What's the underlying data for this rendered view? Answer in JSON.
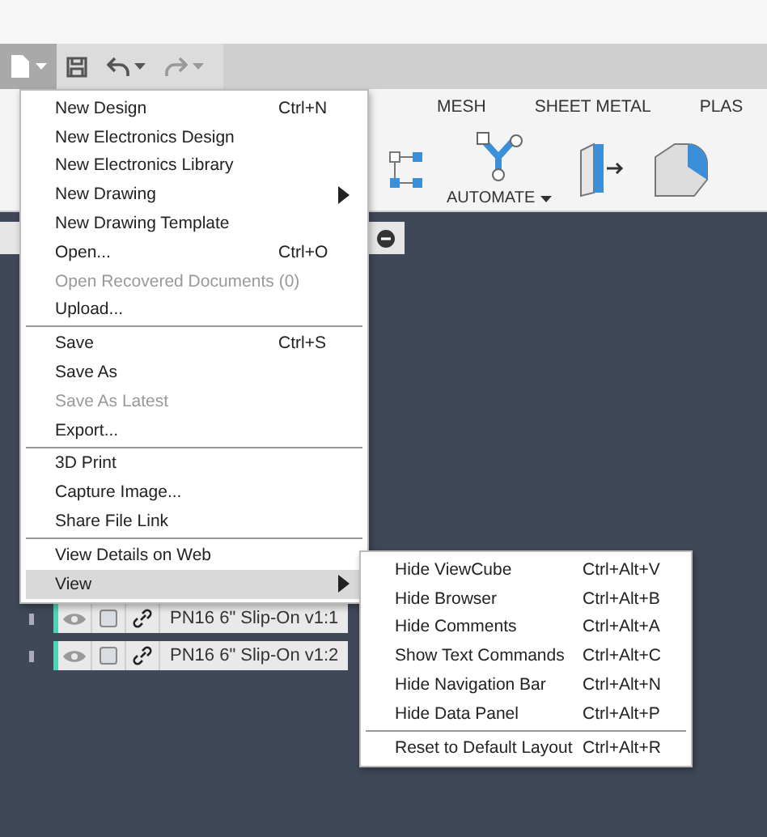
{
  "ribbon": {
    "tabs": [
      {
        "label": "MESH"
      },
      {
        "label": "SHEET METAL"
      },
      {
        "label": "PLAS"
      }
    ],
    "automate": {
      "label": "AUTOMATE"
    }
  },
  "file_menu": {
    "items": [
      {
        "kind": "item",
        "label": "New Design",
        "shortcut": "Ctrl+N",
        "disabled": false,
        "submenu": false,
        "selected": false
      },
      {
        "kind": "item",
        "label": "New Electronics Design",
        "disabled": false,
        "submenu": false,
        "selected": false
      },
      {
        "kind": "item",
        "label": "New Electronics Library",
        "disabled": false,
        "submenu": false,
        "selected": false
      },
      {
        "kind": "item",
        "label": "New Drawing",
        "disabled": false,
        "submenu": true,
        "selected": false
      },
      {
        "kind": "item",
        "label": "New Drawing Template",
        "disabled": false,
        "submenu": false,
        "selected": false
      },
      {
        "kind": "item",
        "label": "Open...",
        "shortcut": "Ctrl+O",
        "disabled": false,
        "submenu": false,
        "selected": false
      },
      {
        "kind": "item",
        "label": "Open Recovered Documents (0)",
        "disabled": true,
        "submenu": false,
        "selected": false
      },
      {
        "kind": "item",
        "label": "Upload...",
        "disabled": false,
        "submenu": false,
        "selected": false
      },
      {
        "kind": "separator"
      },
      {
        "kind": "item",
        "label": "Save",
        "shortcut": "Ctrl+S",
        "disabled": false,
        "submenu": false,
        "selected": false
      },
      {
        "kind": "item",
        "label": "Save As",
        "disabled": false,
        "submenu": false,
        "selected": false
      },
      {
        "kind": "item",
        "label": "Save As Latest",
        "disabled": true,
        "submenu": false,
        "selected": false
      },
      {
        "kind": "item",
        "label": "Export...",
        "disabled": false,
        "submenu": false,
        "selected": false
      },
      {
        "kind": "separator"
      },
      {
        "kind": "item",
        "label": "3D Print",
        "disabled": false,
        "submenu": false,
        "selected": false
      },
      {
        "kind": "item",
        "label": "Capture Image...",
        "disabled": false,
        "submenu": false,
        "selected": false
      },
      {
        "kind": "item",
        "label": "Share File Link",
        "disabled": false,
        "submenu": false,
        "selected": false
      },
      {
        "kind": "separator"
      },
      {
        "kind": "item",
        "label": "View Details on Web",
        "disabled": false,
        "submenu": false,
        "selected": false
      },
      {
        "kind": "item",
        "label": "View",
        "disabled": false,
        "submenu": true,
        "selected": true
      }
    ]
  },
  "view_submenu": {
    "items": [
      {
        "kind": "item",
        "label": "Hide ViewCube",
        "shortcut": "Ctrl+Alt+V"
      },
      {
        "kind": "item",
        "label": "Hide Browser",
        "shortcut": "Ctrl+Alt+B"
      },
      {
        "kind": "item",
        "label": "Hide Comments",
        "shortcut": "Ctrl+Alt+A"
      },
      {
        "kind": "item",
        "label": "Show Text Commands",
        "shortcut": "Ctrl+Alt+C"
      },
      {
        "kind": "item",
        "label": "Hide Navigation Bar",
        "shortcut": "Ctrl+Alt+N"
      },
      {
        "kind": "item",
        "label": "Hide Data Panel",
        "shortcut": "Ctrl+Alt+P"
      },
      {
        "kind": "separator"
      },
      {
        "kind": "item",
        "label": "Reset to Default Layout",
        "shortcut": "Ctrl+Alt+R"
      }
    ]
  },
  "browser": {
    "rows": [
      {
        "name": "PN16 6\" Slip-On v1:1"
      },
      {
        "name": "PN16 6\" Slip-On v1:2"
      }
    ]
  }
}
